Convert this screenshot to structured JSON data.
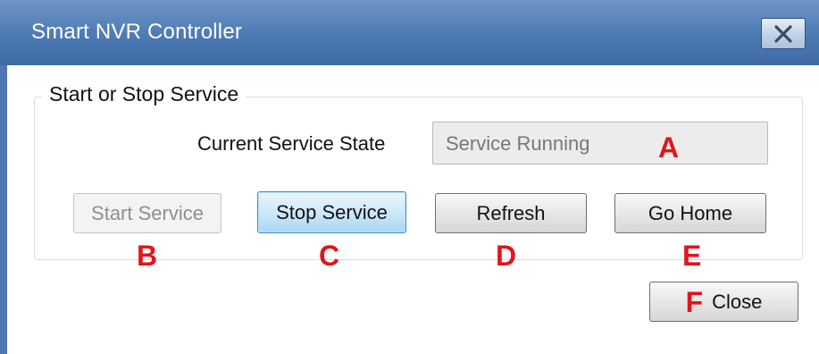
{
  "window": {
    "title": "Smart NVR Controller",
    "close_icon": "close-x-icon"
  },
  "group": {
    "legend": "Start or Stop Service",
    "state_label": "Current Service State",
    "state_value": "Service Running"
  },
  "buttons": {
    "start": "Start Service",
    "stop": "Stop Service",
    "refresh": "Refresh",
    "go_home": "Go Home",
    "close": "Close"
  },
  "markers": {
    "a": "A",
    "b": "B",
    "c": "C",
    "d": "D",
    "e": "E",
    "f": "F"
  },
  "colors": {
    "titlebar": "#4d7ab4",
    "marker": "#e0161b",
    "focus_button": "#a9d5f4"
  }
}
